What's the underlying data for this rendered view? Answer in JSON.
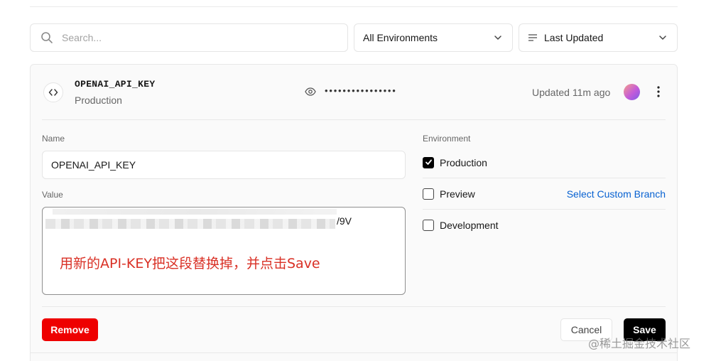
{
  "search": {
    "placeholder": "Search..."
  },
  "filters": {
    "environment": "All Environments",
    "sort": "Last Updated"
  },
  "variable": {
    "key": "OPENAI_API_KEY",
    "environment": "Production",
    "masked_value": "••••••••••••••••",
    "updated": "Updated 11m ago"
  },
  "form": {
    "name_label": "Name",
    "name_value": "OPENAI_API_KEY",
    "value_label": "Value",
    "value_visible_tail": "/9V",
    "annotation": "用新的API-KEY把这段替换掉，并点击Save",
    "environment_label": "Environment",
    "environments": [
      {
        "label": "Production",
        "checked": true
      },
      {
        "label": "Preview",
        "checked": false
      },
      {
        "label": "Development",
        "checked": false
      }
    ],
    "custom_branch": "Select Custom Branch"
  },
  "actions": {
    "remove": "Remove",
    "cancel": "Cancel",
    "save": "Save"
  },
  "watermark": "@稀土掘金技术社区",
  "colors": {
    "danger": "#ee0000",
    "link": "#0761d1",
    "annotation": "#d93025",
    "primary": "#000000"
  },
  "icons": [
    "search-icon",
    "chevron-down-icon",
    "sort-lines-icon",
    "code-icon",
    "eye-icon",
    "more-vertical-icon",
    "check-icon"
  ]
}
